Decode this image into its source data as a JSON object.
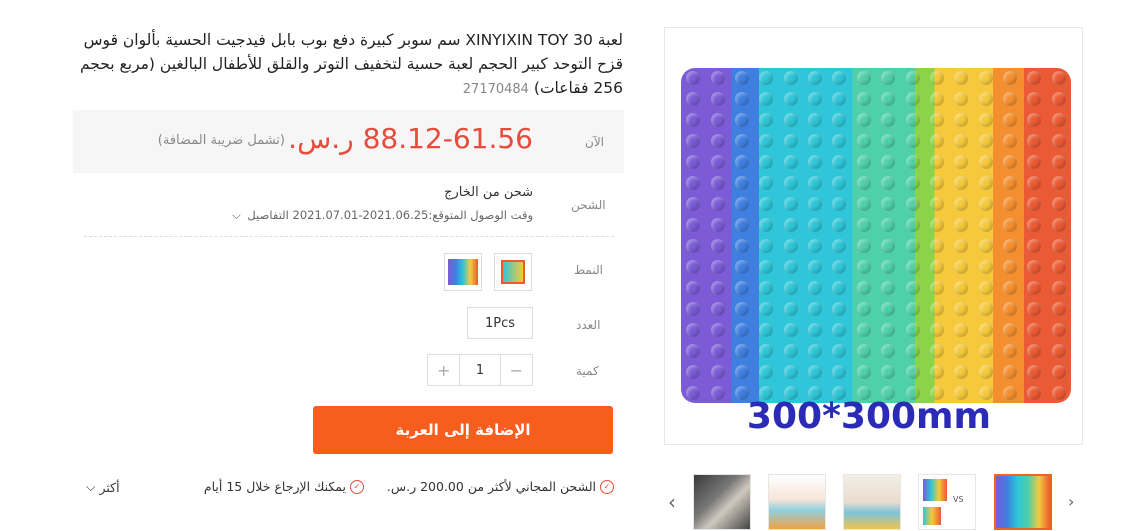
{
  "product": {
    "title": "لعبة XINYIXIN TOY 30 سم سوبر كبيرة دفع بوب بابل فيدجيت الحسية بألوان قوس قزح التوحد كبير الحجم لعبة حسية لتخفيف التوتر والقلق للأطفال البالغين (مربع بحجم 256 فقاعات)",
    "sku": "27170484",
    "image_caption": "300*300mm"
  },
  "price": {
    "label": "الآن",
    "value": "88.12-61.56 ر.س.",
    "vat_note": "(تشمل ضريبة المضافة)"
  },
  "shipping": {
    "label": "الشحن",
    "main": "شحن من الخارج",
    "eta": "وقت الوصول المتوقع:2021.06.25-2021.07.01 التفاصيل"
  },
  "style": {
    "label": "النمط"
  },
  "count": {
    "label": "العدد",
    "option": "1Pcs"
  },
  "quantity": {
    "label": "كمية",
    "value": "1",
    "plus": "+",
    "minus": "−"
  },
  "cart": {
    "add_label": "الإضافة إلى العربة"
  },
  "promos": {
    "free_shipping": "الشحن المجاني لأكثر من 200.00 ر.س.",
    "returns": "يمكنك الإرجاع خلال 15 أيام",
    "more": "أكثر"
  },
  "thumbnails": [
    "thumb-rainbow-square",
    "thumb-size-compare",
    "thumb-kids-playing-1",
    "thumb-kids-playing-2",
    "thumb-car-seat"
  ],
  "colors": {
    "accent": "#f75d1c",
    "price": "#e84a3c"
  }
}
